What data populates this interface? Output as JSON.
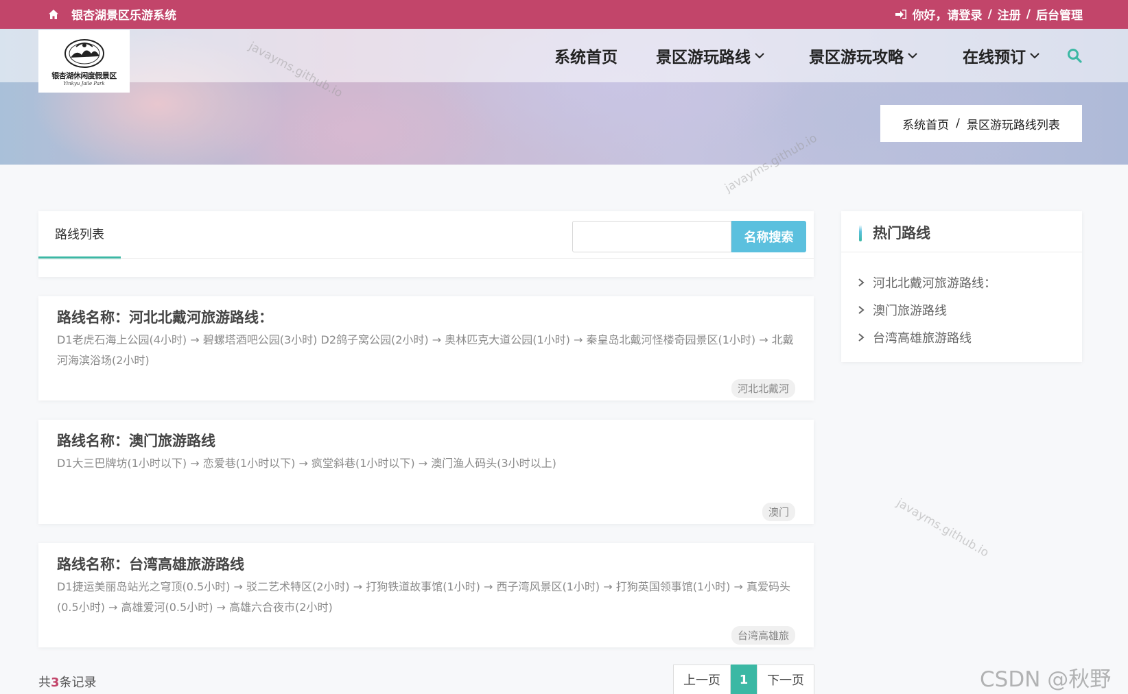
{
  "topbar": {
    "site_name": "银杏湖景区乐游系统",
    "greeting": "你好，请登录",
    "sep1": "/",
    "register": "注册",
    "sep2": "/",
    "admin": "后台管理",
    "bg_color": "#c2456a"
  },
  "logo": {
    "text": "银杏湖休闲度假景区",
    "subtext": "Yinkyu Jaile Park"
  },
  "nav": {
    "items": [
      {
        "label": "系统首页",
        "dropdown": false
      },
      {
        "label": "景区游玩路线",
        "dropdown": true
      },
      {
        "label": "景区游玩攻略",
        "dropdown": true
      },
      {
        "label": "在线预订",
        "dropdown": true
      }
    ],
    "search_icon": "search-icon"
  },
  "breadcrumb": {
    "home": "系统首页",
    "separator": "/",
    "current": "景区游玩路线列表"
  },
  "watermark": "javayms.github.io",
  "list": {
    "tab_label": "路线列表",
    "search_placeholder": "",
    "search_button": "名称搜索",
    "routes": [
      {
        "title": "路线名称：河北北戴河旅游路线：",
        "desc": "D1老虎石海上公园(4小时) → 碧螺塔酒吧公园(3小时) D2鸽子窝公园(2小时) → 奥林匹克大道公园(1小时) → 秦皇岛北戴河怪楼奇园景区(1小时) → 北戴河海滨浴场(2小时)",
        "tag": "河北北戴河"
      },
      {
        "title": "路线名称：澳门旅游路线",
        "desc": "D1大三巴牌坊(1小时以下) → 恋爱巷(1小时以下) → 疯堂斜巷(1小时以下) → 澳门渔人码头(3小时以上)",
        "tag": "澳门"
      },
      {
        "title": "路线名称：台湾高雄旅游路线",
        "desc": "D1捷运美丽岛站光之穹顶(0.5小时) → 驳二艺术特区(2小时) → 打狗铁道故事馆(1小时) → 西子湾风景区(1小时) → 打狗英国领事馆(1小时) → 真爱码头(0.5小时) → 高雄爱河(0.5小时) → 高雄六合夜市(2小时)",
        "tag": "台湾高雄旅"
      }
    ]
  },
  "records": {
    "prefix": "共",
    "count": "3",
    "suffix": "条记录"
  },
  "pager": {
    "prev": "上一页",
    "current": "1",
    "next": "下一页"
  },
  "hot": {
    "title": "热门路线",
    "items": [
      "河北北戴河旅游路线：",
      "澳门旅游路线",
      "台湾高雄旅游路线"
    ]
  },
  "corner_watermark": "CSDN @秋野酱",
  "colors": {
    "accent": "#3bb8a4",
    "search_button": "#5bc0de",
    "brand": "#c2456a"
  }
}
